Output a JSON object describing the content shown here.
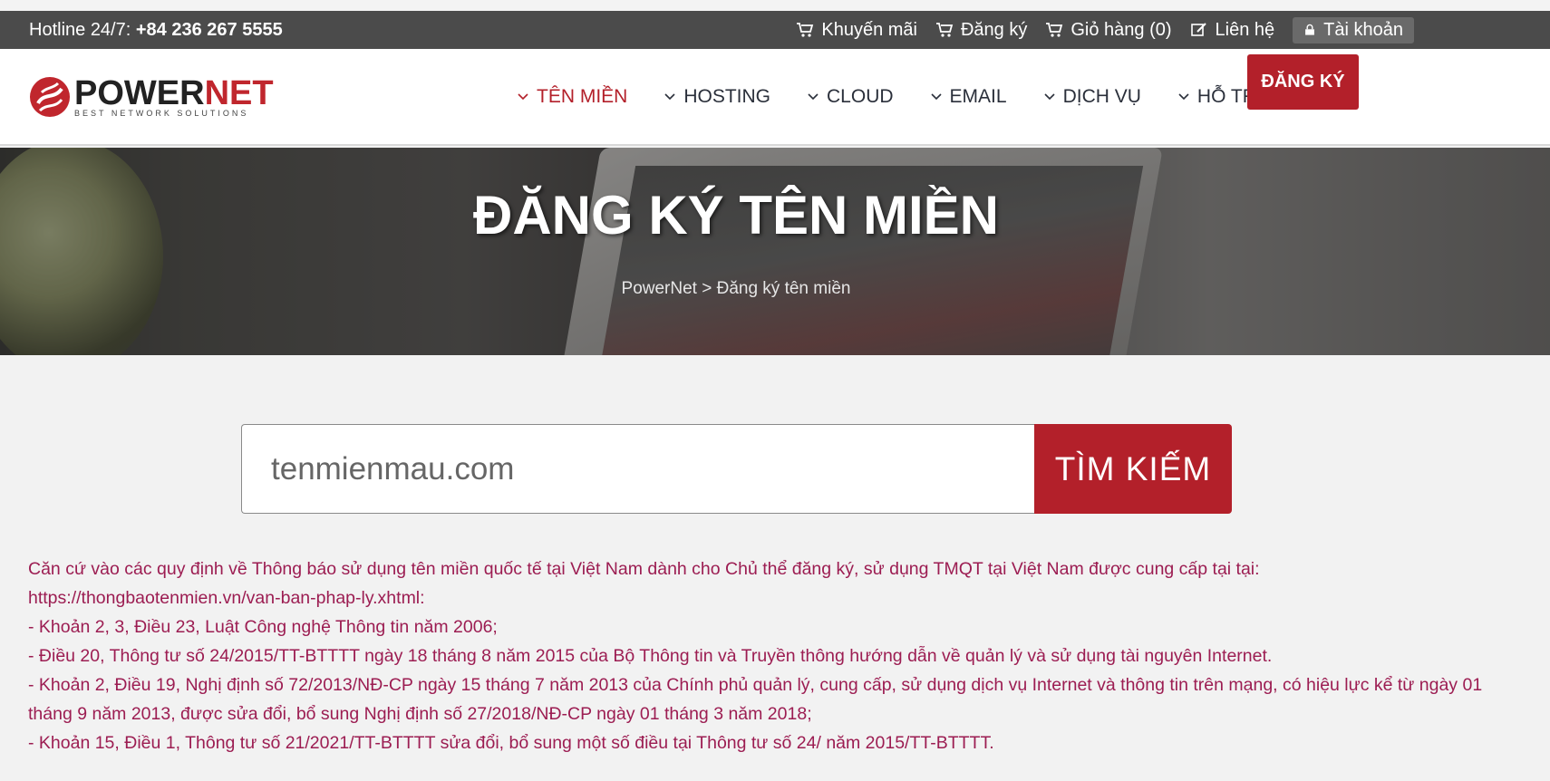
{
  "topbar": {
    "hotline_label": "Hotline 24/7: ",
    "hotline_number": "+84 236 267 5555",
    "links": [
      {
        "label": "Khuyến mãi",
        "icon": "cart-icon"
      },
      {
        "label": "Đăng ký",
        "icon": "cart-icon"
      },
      {
        "label": "Giỏ hàng (0)",
        "icon": "cart-icon"
      },
      {
        "label": "Liên hệ",
        "icon": "edit-icon"
      }
    ],
    "account_label": "Tài khoản"
  },
  "logo": {
    "word_a": "POWER",
    "word_b": "NET",
    "tagline": "BEST NETWORK SOLUTIONS"
  },
  "nav": {
    "items": [
      "TÊN MIỀN",
      "HOSTING",
      "CLOUD",
      "EMAIL",
      "DỊCH VỤ",
      "HỖ TRỢ"
    ],
    "active_index": 0,
    "register_label": "ĐĂNG KÝ"
  },
  "hero": {
    "title": "ĐĂNG KÝ TÊN MIỀN",
    "breadcrumb": "PowerNet > Đăng ký tên miền"
  },
  "search": {
    "placeholder": "tenmienmau.com",
    "button_label": "TÌM KIẾM"
  },
  "notice": {
    "lines": [
      "Căn cứ vào các quy định về Thông báo sử dụng tên miền quốc tế tại Việt Nam dành cho Chủ thể đăng ký, sử dụng TMQT tại Việt Nam được cung cấp tại tại:",
      "https://thongbaotenmien.vn/van-ban-phap-ly.xhtml:",
      "- Khoản 2, 3, Điều 23, Luật Công nghệ Thông tin năm 2006;",
      "- Điều 20, Thông tư số 24/2015/TT-BTTTT ngày 18 tháng 8 năm 2015 của Bộ Thông tin và Truyền thông hướng dẫn về quản lý và sử dụng tài nguyên Internet.",
      "- Khoản 2, Điều 19, Nghị định số 72/2013/NĐ-CP ngày 15 tháng 7 năm 2013 của Chính phủ quản lý, cung cấp, sử dụng dịch vụ Internet và thông tin trên mạng, có hiệu lực kể từ ngày 01 tháng 9 năm 2013, được sửa đổi, bổ sung Nghị định số 27/2018/NĐ-CP ngày 01 tháng 3 năm 2018;",
      "- Khoản 15, Điều 1, Thông tư số 21/2021/TT-BTTTT sửa đổi, bổ sung một số điều tại Thông tư số 24/ năm 2015/TT-BTTTT."
    ]
  },
  "colors": {
    "brand_red": "#b3202a",
    "notice_text": "#9c1d52",
    "topbar_bg": "#4b4b4b"
  }
}
